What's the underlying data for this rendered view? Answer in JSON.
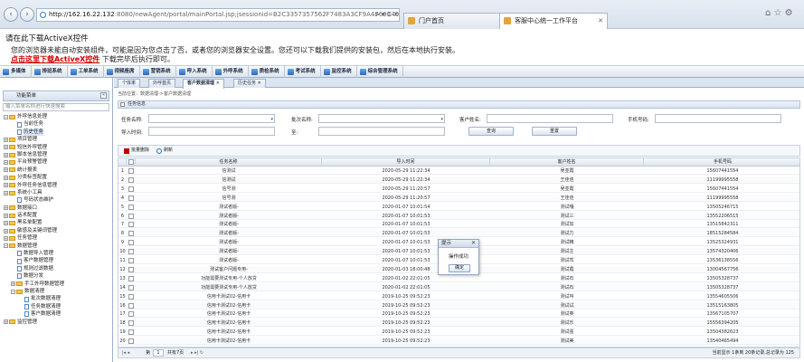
{
  "browser": {
    "url_host": "http://162.16.22.132",
    "url_rest": ":8080/newAgent/portal/mainPortal.jsp;jsessionid=B2C3357357562F7483A3CF9A476934040",
    "addr_controls": "⊳ ▾ C ✕",
    "tabs": [
      {
        "label": "门户首页"
      },
      {
        "label": "客服中心统一工作平台"
      }
    ],
    "window_controls": "⌂ ☆ ⚙"
  },
  "infobar": {
    "title": "请在此下载ActiveX控件",
    "line1": "您的浏览器未能自动安装组件，可能是因为您点击了否，或者您的浏览器安全设置。您还可以下载我们提供的安装包，然后在本地执行安装。",
    "link": "点击这里下载ActiveX控件",
    "line2_suffix": "下载完毕后执行即可。"
  },
  "menu": [
    "多媒体",
    "排班系统",
    "工单系统",
    "视频座席",
    "营销系统",
    "呼入系统",
    "外呼系统",
    "质检系统",
    "考试系统",
    "监控系统",
    "综合管理系统"
  ],
  "left": {
    "header": "功能菜单",
    "search_placeholder": "输入菜单名称进行快速搜索",
    "tree": [
      {
        "label": "外呼信息处理",
        "level": 0,
        "type": "folder",
        "expanded": true
      },
      {
        "label": "当前任务",
        "level": 1,
        "type": "doc"
      },
      {
        "label": "历史任务",
        "level": 1,
        "type": "doc",
        "selected": true
      },
      {
        "label": "项目管理",
        "level": 0,
        "type": "folder"
      },
      {
        "label": "短信外呼管理",
        "level": 0,
        "type": "folder"
      },
      {
        "label": "脚本信息管理",
        "level": 0,
        "type": "folder"
      },
      {
        "label": "平台预警管理",
        "level": 0,
        "type": "folder"
      },
      {
        "label": "统计报表",
        "level": 0,
        "type": "folder"
      },
      {
        "label": "分类标签配置",
        "level": 0,
        "type": "folder"
      },
      {
        "label": "外呼任务信息管理",
        "level": 0,
        "type": "folder"
      },
      {
        "label": "系统小工具",
        "level": 0,
        "type": "folder"
      },
      {
        "label": "号码状态维护",
        "level": 1,
        "type": "doc"
      },
      {
        "label": "数据接口",
        "level": 0,
        "type": "folder"
      },
      {
        "label": "话术配置",
        "level": 0,
        "type": "folder"
      },
      {
        "label": "黑名单配置",
        "level": 0,
        "type": "folder"
      },
      {
        "label": "敏感及关键词管理",
        "level": 0,
        "type": "folder"
      },
      {
        "label": "任务管理",
        "level": 0,
        "type": "folder"
      },
      {
        "label": "数据管理",
        "level": 0,
        "type": "folder",
        "expanded": true
      },
      {
        "label": "数据导入管理",
        "level": 1,
        "type": "doc"
      },
      {
        "label": "客户数据管理",
        "level": 1,
        "type": "doc"
      },
      {
        "label": "规则过滤数据",
        "level": 1,
        "type": "doc"
      },
      {
        "label": "数据分发",
        "level": 1,
        "type": "doc"
      },
      {
        "label": "手工外呼数据管理",
        "level": 1,
        "type": "folder"
      },
      {
        "label": "数据清理",
        "level": 1,
        "type": "folder",
        "expanded": true
      },
      {
        "label": "批次数据清理",
        "level": 2,
        "type": "doc"
      },
      {
        "label": "任务数据清理",
        "level": 2,
        "type": "doc"
      },
      {
        "label": "客户数据清理",
        "level": 2,
        "type": "doc"
      },
      {
        "label": "监控管理",
        "level": 0,
        "type": "folder"
      }
    ]
  },
  "main": {
    "tabs": [
      {
        "label": "个体率"
      },
      {
        "label": "外呼首页"
      },
      {
        "label": "客户数据清理 ✕",
        "active": true
      },
      {
        "label": "历史任务 ✕"
      }
    ],
    "breadcrumb": "当前位置：数据清理->客户数据清理",
    "panel_title": "任务信息",
    "filters": {
      "task_name_label": "任务名称:",
      "batch_name_label": "批次名称:",
      "customer_name_label": "客户姓名:",
      "phone_label": "手机号码:",
      "import_time_label": "导入时间:",
      "to_label": "至:",
      "query_button": "查询",
      "reset_button": "重置"
    },
    "toolbar": {
      "delete": "批量删除",
      "refresh": "刷新"
    },
    "columns": [
      "",
      "",
      "任务名称",
      "导入时间",
      "客户姓名",
      "手机号码"
    ],
    "rows": [
      {
        "n": "1",
        "task": "信测试",
        "time": "2020-05-29 11:22:34",
        "name": "吴亚霞",
        "phone": "15607441554"
      },
      {
        "n": "2",
        "task": "信测试",
        "time": "2020-05-29 11:22:34",
        "name": "王佳佳",
        "phone": "11199995558"
      },
      {
        "n": "3",
        "task": "信号测",
        "time": "2020-05-29 11:20:57",
        "name": "吴亚霞",
        "phone": "15607441554"
      },
      {
        "n": "4",
        "task": "信号测",
        "time": "2020-05-29 11:20:57",
        "name": "王佳佳",
        "phone": "11199995558"
      },
      {
        "n": "5",
        "task": "测试者版-",
        "time": "2020-01-07 10:01:54",
        "name": "测试嘎",
        "phone": "13505246715"
      },
      {
        "n": "6",
        "task": "测试者版-",
        "time": "2020-01-07 10:01:53",
        "name": "测试三",
        "phone": "13552206515"
      },
      {
        "n": "7",
        "task": "测试者版-",
        "time": "2020-01-07 10:01:53",
        "name": "测试加",
        "phone": "13515842311"
      },
      {
        "n": "8",
        "task": "测试者版-",
        "time": "2020-01-07 10:01:53",
        "name": "测试力",
        "phone": "18515284584"
      },
      {
        "n": "9",
        "task": "测试者版-",
        "time": "2020-01-07 10:01:53",
        "name": "测试精",
        "phone": "13525324931"
      },
      {
        "n": "10",
        "task": "测试者版-",
        "time": "2020-01-07 10:01:53",
        "name": "测试主",
        "phone": "13574320406"
      },
      {
        "n": "11",
        "task": "测试者版-",
        "time": "2020-01-07 10:01:53",
        "name": "测试驾",
        "phone": "13536138556"
      },
      {
        "n": "12",
        "task": "测试客户问题专用-",
        "time": "2020-01-03 18:00:48",
        "name": "测试霞",
        "phone": "13004567756"
      },
      {
        "n": "13",
        "task": "功能需要测试专用-个人放贷",
        "time": "2020-01-02 22:01:05",
        "name": "测试石",
        "phone": "13505328737"
      },
      {
        "n": "14",
        "task": "功能需要测试专用-个人放贷",
        "time": "2020-01-02 22:01:05",
        "name": "测试石",
        "phone": "13505328737"
      },
      {
        "n": "15",
        "task": "信用卡测试02-信用卡",
        "time": "2019-10-25 09:52:23",
        "name": "测试叫",
        "phone": "13554605506"
      },
      {
        "n": "16",
        "task": "信用卡测试02-信用卡",
        "time": "2019-10-25 09:52:23",
        "name": "测试试",
        "phone": "13515163805"
      },
      {
        "n": "17",
        "task": "信用卡测试02-信用卡",
        "time": "2019-10-25 09:52:23",
        "name": "测试英",
        "phone": "13567105707"
      },
      {
        "n": "18",
        "task": "信用卡测试02-信用卡",
        "time": "2019-10-25 09:52:23",
        "name": "测试乐",
        "phone": "15556394205"
      },
      {
        "n": "19",
        "task": "信用卡测试02-信用卡",
        "time": "2019-10-25 09:52:23",
        "name": "测试强",
        "phone": "13504382623"
      },
      {
        "n": "20",
        "task": "信用卡测试02-信用卡",
        "time": "2019-10-25 09:52:23",
        "name": "测试美",
        "phone": "13540465494"
      }
    ],
    "pager": {
      "page_label": "第",
      "page_value": "1",
      "of_label": "共有7页",
      "summary": "当前显示 1条到 20条记录,总记录为 125"
    }
  },
  "dialog": {
    "title": "提示",
    "message": "操作成功",
    "ok": "确定"
  },
  "colors": {
    "accent": "#2e67b8",
    "header_bg": "#dfe6ef",
    "delete_red": "#c00000"
  }
}
